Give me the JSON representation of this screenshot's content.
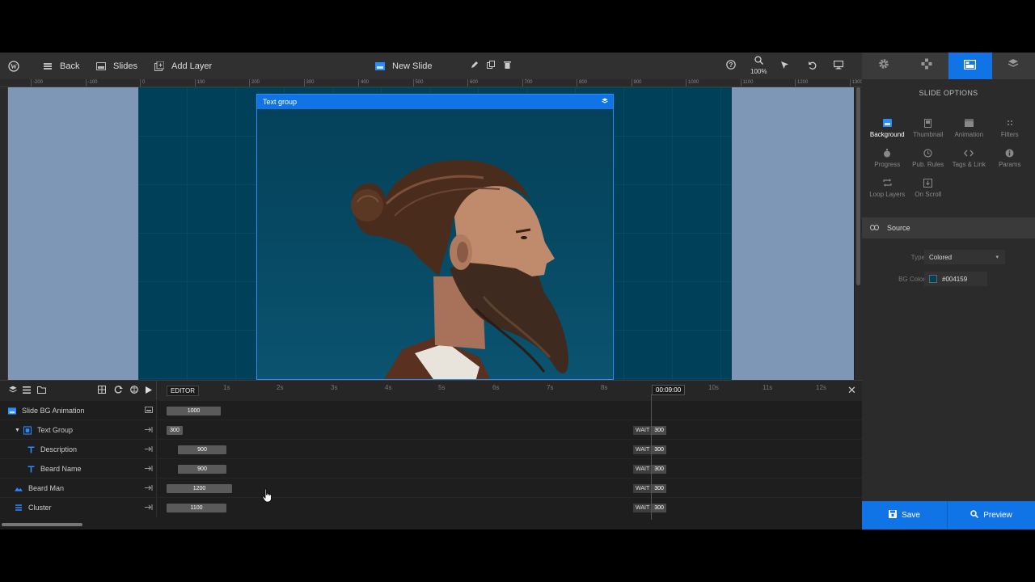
{
  "toolbar": {
    "back_label": "Back",
    "slides_label": "Slides",
    "add_layer_label": "Add Layer",
    "slide_name": "New Slide",
    "zoom_level": "100%"
  },
  "ruler": {
    "ticks": [
      "-200",
      "-100",
      "0",
      "100",
      "200",
      "300",
      "400",
      "500",
      "600",
      "700",
      "800",
      "900",
      "1000",
      "1100",
      "1200",
      "1300"
    ]
  },
  "canvas": {
    "layer_title": "Text group",
    "slide_bg": "#004159"
  },
  "panel": {
    "title": "SLIDE OPTIONS",
    "options": [
      {
        "label": "Background",
        "icon": "image-icon",
        "active": true
      },
      {
        "label": "Thumbnail",
        "icon": "thumbnail-icon"
      },
      {
        "label": "Animation",
        "icon": "clapper-icon"
      },
      {
        "label": "Filters",
        "icon": "filters-icon"
      },
      {
        "label": "Progress",
        "icon": "stopwatch-icon"
      },
      {
        "label": "Pub. Rules",
        "icon": "clock-icon"
      },
      {
        "label": "Tags & Link",
        "icon": "code-icon"
      },
      {
        "label": "Params",
        "icon": "info-icon"
      },
      {
        "label": "Loop Layers",
        "icon": "loop-icon"
      },
      {
        "label": "On Scroll",
        "icon": "scroll-icon"
      }
    ],
    "source_label": "Source",
    "type_label": "Type",
    "type_value": "Colored",
    "bg_color_label": "BG Color",
    "bg_color_value": "#004159"
  },
  "actions": {
    "save_label": "Save",
    "preview_label": "Preview"
  },
  "timeline": {
    "editor_label": "EDITOR",
    "ticks": [
      "1s",
      "2s",
      "3s",
      "4s",
      "5s",
      "6s",
      "7s",
      "8s",
      "10s",
      "11s",
      "12s"
    ],
    "current_time": "00:09:00",
    "wait_label": "WAIT",
    "rows": [
      {
        "name": "Slide BG Animation",
        "duration": "1000"
      },
      {
        "name": "Text Group",
        "duration": "300",
        "wait": "300"
      },
      {
        "name": "Description",
        "duration": "900",
        "wait": "300"
      },
      {
        "name": "Beard Name",
        "duration": "900",
        "wait": "300"
      },
      {
        "name": "Beard Man",
        "duration": "1200",
        "wait": "300"
      },
      {
        "name": "Cluster",
        "duration": "1100",
        "wait": "300"
      }
    ]
  },
  "colors": {
    "accent": "#1174e6",
    "toolbar_bg": "#303030",
    "canvas_bg": "#7f97b6"
  }
}
